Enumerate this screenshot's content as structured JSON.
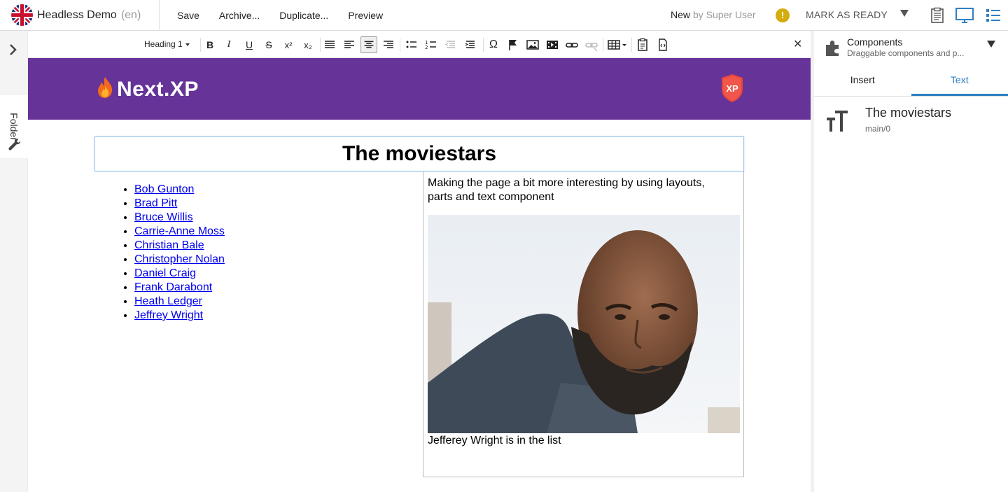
{
  "app": {
    "site_name": "Headless Demo",
    "language": "(en)"
  },
  "actions": [
    "Save",
    "Archive...",
    "Duplicate...",
    "Preview"
  ],
  "status": {
    "state": "New",
    "by": "by Super User",
    "warning": "!",
    "mark_ready": "MARK AS READY"
  },
  "leftrail": {
    "folder_label": "Folder"
  },
  "toolbar": {
    "format": "Heading 1"
  },
  "site": {
    "logo_text": "Next.XP",
    "badge": "XP"
  },
  "content": {
    "heading": "The moviestars",
    "people": [
      "Bob Gunton",
      "Brad Pitt",
      "Bruce Willis",
      "Carrie-Anne Moss",
      "Christian Bale",
      "Christopher Nolan",
      "Daniel Craig",
      "Frank Darabont",
      "Heath Ledger",
      "Jeffrey Wright"
    ],
    "intro": "Making the page a bit more interesting by using layouts, parts and text component",
    "caption": "Jefferey Wright is in the list"
  },
  "panel": {
    "title": "Components",
    "subtitle": "Draggable components and p...",
    "tabs": [
      "Insert",
      "Text"
    ],
    "active_tab": "Text",
    "item_title": "The moviestars",
    "item_path": "main/0"
  },
  "colors": {
    "header_purple": "#663399",
    "accent_blue": "#2f7fc1",
    "link_blue": "#0000ee",
    "warning_yellow": "#d4ac0d"
  }
}
